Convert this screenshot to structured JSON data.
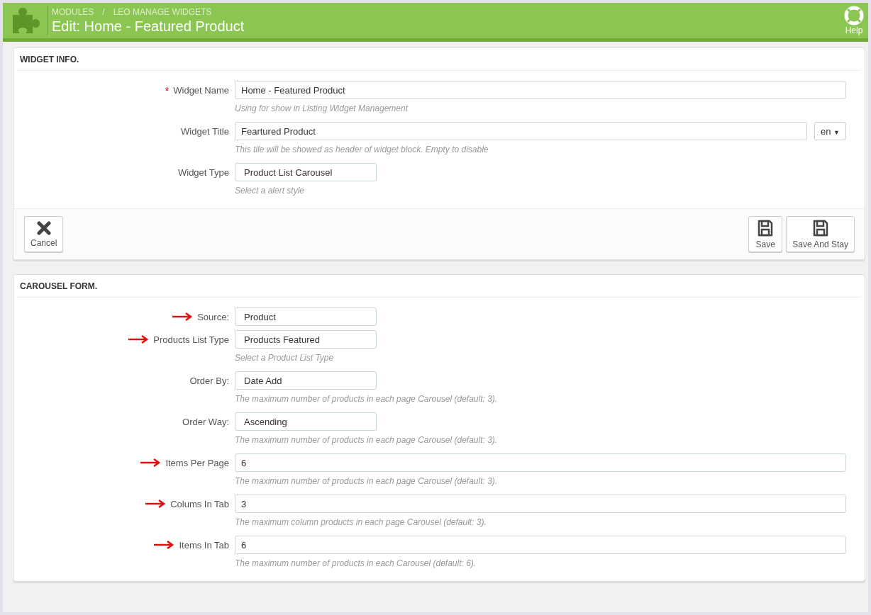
{
  "header": {
    "breadcrumb": [
      "MODULES",
      "LEO MANAGE WIDGETS"
    ],
    "separator": "/",
    "title": "Edit: Home - Featured Product",
    "help": "Help"
  },
  "required_symbol": "*",
  "panels": [
    {
      "heading": "WIDGET INFO.",
      "fields": [
        {
          "label": "Widget Name",
          "required": true,
          "marked": false,
          "kind": "text",
          "value": "Home - Featured Product",
          "hint": "Using for show in Listing Widget Management"
        },
        {
          "label": "Widget Title",
          "required": false,
          "marked": false,
          "kind": "text",
          "value": "Feartured Product",
          "language": {
            "label": "en",
            "caret": "▼"
          },
          "hint": "This tile will be showed as header of widget block. Empty to disable"
        },
        {
          "label": "Widget Type",
          "required": false,
          "marked": false,
          "kind": "select",
          "value": "Product List Carousel",
          "hint": "Select a alert style"
        }
      ],
      "footer": {
        "left": [
          {
            "label": "Cancel",
            "kind": "cancel"
          }
        ],
        "right": [
          {
            "label": "Save",
            "kind": "save"
          },
          {
            "label": "Save And Stay",
            "kind": "save"
          }
        ]
      }
    },
    {
      "heading": "CAROUSEL FORM.",
      "fields": [
        {
          "label": "Source:",
          "required": false,
          "marked": true,
          "kind": "select",
          "value": "Product"
        },
        {
          "label": "Products List Type",
          "required": false,
          "marked": true,
          "kind": "select",
          "value": "Products Featured",
          "hint": "Select a Product List Type"
        },
        {
          "label": "Order By:",
          "required": false,
          "marked": false,
          "kind": "select",
          "value": "Date Add",
          "hint": "The maximum number of products in each page Carousel (default: 3)."
        },
        {
          "label": "Order Way:",
          "required": false,
          "marked": false,
          "kind": "select",
          "value": "Ascending",
          "hint": "The maximum number of products in each page Carousel (default: 3)."
        },
        {
          "label": "Items Per Page",
          "required": false,
          "marked": true,
          "kind": "text",
          "value": "6",
          "hint": "The maximum number of products in each page Carousel (default: 3)."
        },
        {
          "label": "Colums In Tab",
          "required": false,
          "marked": true,
          "kind": "text",
          "value": "3",
          "hint": "The maximum column products in each page Carousel (default: 3)."
        },
        {
          "label": "Items In Tab",
          "required": false,
          "marked": true,
          "kind": "text",
          "value": "6",
          "hint": "The maximum number of products in each Carousel (default: 6)."
        }
      ]
    }
  ]
}
